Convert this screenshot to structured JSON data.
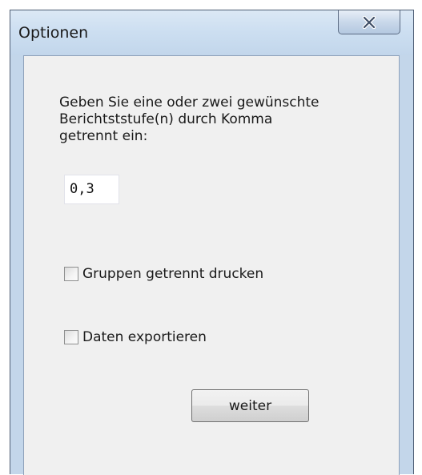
{
  "window": {
    "title": "Optionen",
    "close_icon": "close-icon"
  },
  "dialog": {
    "prompt": "Geben Sie eine oder zwei gewünschte\nBerichtststufe(n) durch Komma\ngetrennt ein:",
    "input_value": "0,3",
    "checkboxes": [
      {
        "label": "Gruppen getrennt drucken",
        "checked": false
      },
      {
        "label": "Daten exportieren",
        "checked": false
      }
    ],
    "button_label": "weiter"
  }
}
